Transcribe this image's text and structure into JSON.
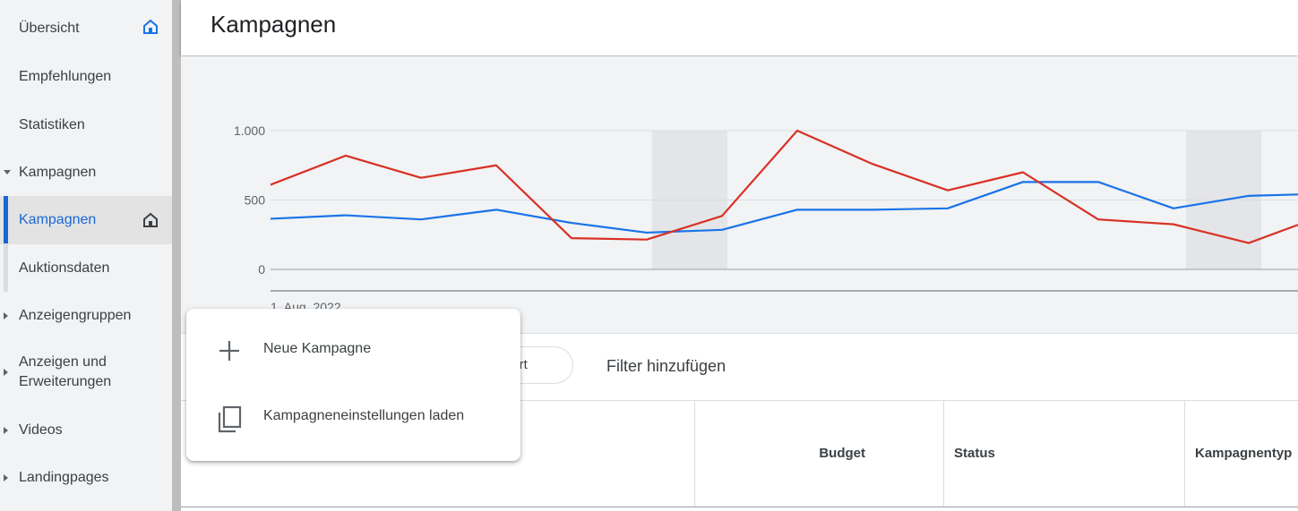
{
  "sidebar": {
    "items": [
      {
        "label": "Übersicht"
      },
      {
        "label": "Empfehlungen"
      },
      {
        "label": "Statistiken"
      },
      {
        "label": "Kampagnen"
      },
      {
        "label": "Kampagnen"
      },
      {
        "label": "Auktionsdaten"
      },
      {
        "label": "Anzeigengruppen"
      },
      {
        "label": "Anzeigen und Erweiterungen"
      },
      {
        "label": "Videos"
      },
      {
        "label": "Landingpages"
      }
    ]
  },
  "header": {
    "title": "Kampagnen"
  },
  "chart_data": {
    "type": "line",
    "x_start_label": "1. Aug. 2022",
    "yticks": [
      "1.000",
      "500",
      "0"
    ],
    "ylim": [
      0,
      1000
    ],
    "grid": true,
    "series": [
      {
        "color": "#d93025",
        "values": [
          610,
          820,
          660,
          750,
          225,
          215,
          385,
          1000,
          760,
          570,
          700,
          360,
          325,
          190,
          390
        ]
      },
      {
        "color": "#1a73e8",
        "values": [
          365,
          390,
          360,
          430,
          335,
          265,
          285,
          430,
          430,
          440,
          630,
          630,
          440,
          530,
          545
        ]
      }
    ]
  },
  "filters": {
    "chip_label": "tiviert",
    "add_filter": "Filter hinzufügen"
  },
  "table": {
    "columns": [
      "Budget",
      "Status",
      "Kampagnentyp"
    ]
  },
  "popup_menu": {
    "items": [
      {
        "label": "Neue Kampagne",
        "icon": "plus-icon"
      },
      {
        "label": "Kampagneneinstellungen laden",
        "icon": "copy-icon"
      }
    ]
  }
}
